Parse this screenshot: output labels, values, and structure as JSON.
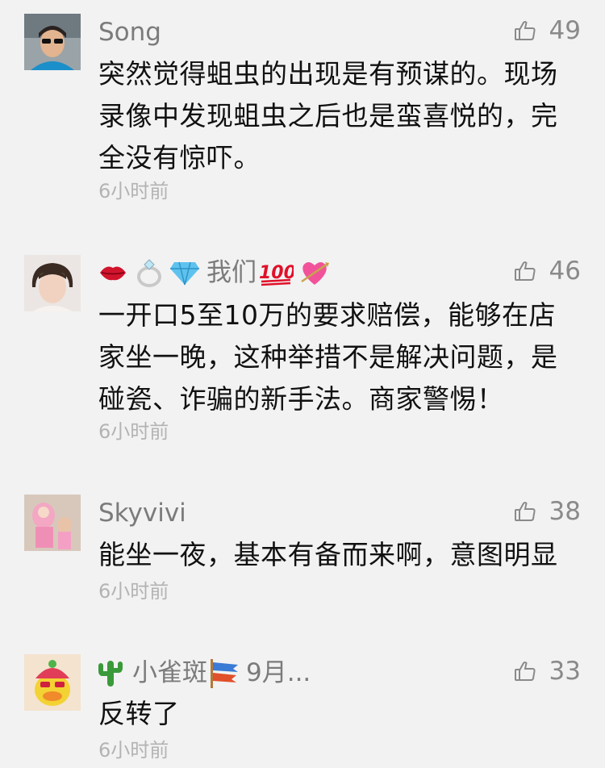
{
  "comments": [
    {
      "name": "Song",
      "likes": "49",
      "text": "突然觉得蛆虫的出现是有预谋的。现场录像中发现蛆虫之后也是蛮喜悦的，完全没有惊吓。",
      "time": "6小时前"
    },
    {
      "name_prefix_icons": [
        "lips-emoji",
        "ring-emoji",
        "gem-emoji"
      ],
      "name": "我们",
      "name_suffix_icons": [
        "hundred-points-emoji",
        "heart-arrow-emoji"
      ],
      "likes": "46",
      "text": "一开口5至10万的要求赔偿，能够在店家坐一晚，这种举措不是解决问题，是碰瓷、诈骗的新手法。商家警惕！",
      "time": "6小时前"
    },
    {
      "name": "Skyvivi",
      "likes": "38",
      "text": "能坐一夜，基本有备而来啊，意图明显",
      "time": "6小时前"
    },
    {
      "name_prefix_icons": [
        "cactus-emoji"
      ],
      "name": "小雀斑",
      "name_suffix_icons": [
        "carp-streamer-emoji"
      ],
      "name_tail": "9月...",
      "likes": "33",
      "text": "反转了",
      "time": "6小时前"
    }
  ],
  "colors": {
    "background": "#f2f2f2",
    "name": "#7b7b7b",
    "text": "#111111",
    "meta": "#b3b3b3",
    "like": "#8a8a8a"
  }
}
